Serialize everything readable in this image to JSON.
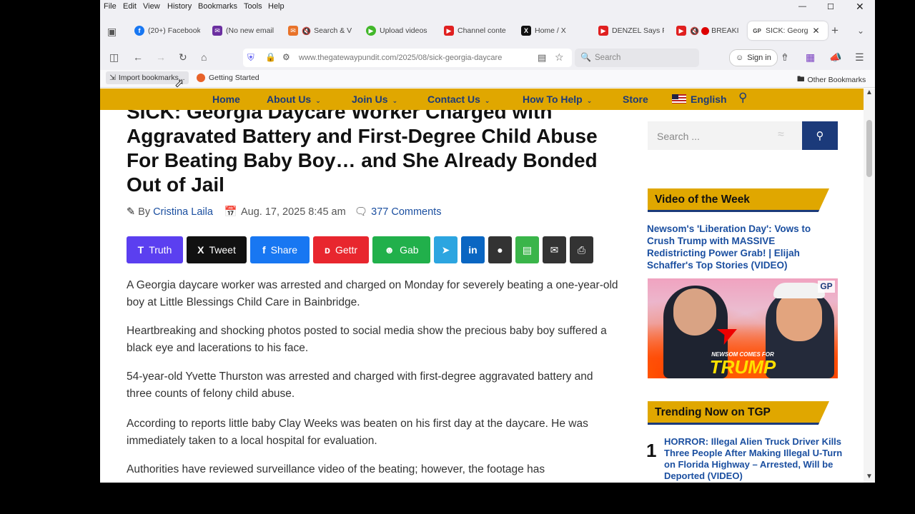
{
  "menu": [
    "File",
    "Edit",
    "View",
    "History",
    "Bookmarks",
    "Tools",
    "Help"
  ],
  "tabs": [
    {
      "label": "(20+) Facebook",
      "color": "#1877f2",
      "glyph": "f"
    },
    {
      "label": "(No new email",
      "color": "#6b2fa0",
      "glyph": "✉"
    },
    {
      "label": "Search & V",
      "color": "#e8732a",
      "glyph": "✉"
    },
    {
      "label": "Upload videos",
      "color": "#42b72a",
      "glyph": "▶"
    },
    {
      "label": "Channel conte",
      "color": "#e02020",
      "glyph": "▶"
    },
    {
      "label": "Home / X",
      "color": "#111111",
      "glyph": "X"
    },
    {
      "label": "DENZEL Says F",
      "color": "#e02020",
      "glyph": "▶"
    },
    {
      "label": "BREAKI",
      "color": "#e02020",
      "glyph": "▶"
    },
    {
      "label": "SICK: Georg",
      "color": "#8a8a8a",
      "glyph": "GP"
    }
  ],
  "url": "www.thegatewaypundit.com/2025/08/sick-georgia-daycare",
  "search_placeholder": "Search",
  "sign_in": "Sign in",
  "bookmarks": {
    "import": "Import bookmarks...",
    "getting_started": "Getting Started",
    "other": "Other Bookmarks"
  },
  "site_nav": [
    {
      "label": "Home",
      "caret": false
    },
    {
      "label": "About Us",
      "caret": true
    },
    {
      "label": "Join Us",
      "caret": true
    },
    {
      "label": "Contact Us",
      "caret": true
    },
    {
      "label": "How To Help",
      "caret": true
    },
    {
      "label": "Store",
      "caret": false
    },
    {
      "label": "English",
      "caret": false
    }
  ],
  "article": {
    "title": "SICK: Georgia Daycare Worker Charged with Aggravated Battery and First-Degree Child Abuse For Beating Baby Boy… and She Already Bonded Out of Jail",
    "by": "By",
    "author": "Cristina Laila",
    "date": "Aug. 17, 2025 8:45 am",
    "comments": "377 Comments",
    "paragraphs": [
      "A Georgia daycare worker was arrested and charged on Monday for severely beating a one-year-old boy at Little Blessings Child Care in Bainbridge.",
      "Heartbreaking and shocking photos posted to social media show the precious baby boy suffered a black eye and lacerations to his face.",
      "54-year-old Yvette Thurston was arrested and charged with first-degree aggravated battery and three counts of felony child abuse.",
      "According to reports little baby Clay Weeks was beaten on his first day at the daycare. He was immediately taken to a local hospital for evaluation.",
      "Authorities have reviewed surveillance video of the beating; however, the footage has"
    ]
  },
  "share_buttons": [
    {
      "label": "Truth",
      "color": "#5b3ff0",
      "icon": "T"
    },
    {
      "label": "Tweet",
      "color": "#111111",
      "icon": "X"
    },
    {
      "label": "Share",
      "color": "#1877f2",
      "icon": "f"
    },
    {
      "label": "Gettr",
      "color": "#e8262e",
      "icon": "G"
    },
    {
      "label": "Gab",
      "color": "#21b04b",
      "icon": "☺"
    },
    {
      "label": "",
      "color": "#2ca5e0",
      "icon": "➤"
    },
    {
      "label": "",
      "color": "#0a66c2",
      "icon": "in"
    },
    {
      "label": "",
      "color": "#333333",
      "icon": "💬"
    },
    {
      "label": "",
      "color": "#3ab54a",
      "icon": "▤"
    },
    {
      "label": "",
      "color": "#333333",
      "icon": "✉"
    },
    {
      "label": "",
      "color": "#333333",
      "icon": "⎙"
    }
  ],
  "sidebar": {
    "search_placeholder": "Search ...",
    "video_header": "Video of the Week",
    "video_title": "Newsom's 'Liberation Day': Vows to Crush Trump with MASSIVE Redistricting Power Grab! | Elijah Schaffer's Top Stories (VIDEO)",
    "thumb_caption_small": "NEWSOM COMES FOR",
    "thumb_caption_big": "TRUMP",
    "thumb_badge": "GP",
    "trending_header": "Trending Now on TGP",
    "trending": [
      {
        "num": "1",
        "title": "HORROR: Illegal Alien Truck Driver Kills Three People After Making Illegal U-Turn on Florida Highway – Arrested, Will be Deported (VIDEO)"
      }
    ]
  }
}
